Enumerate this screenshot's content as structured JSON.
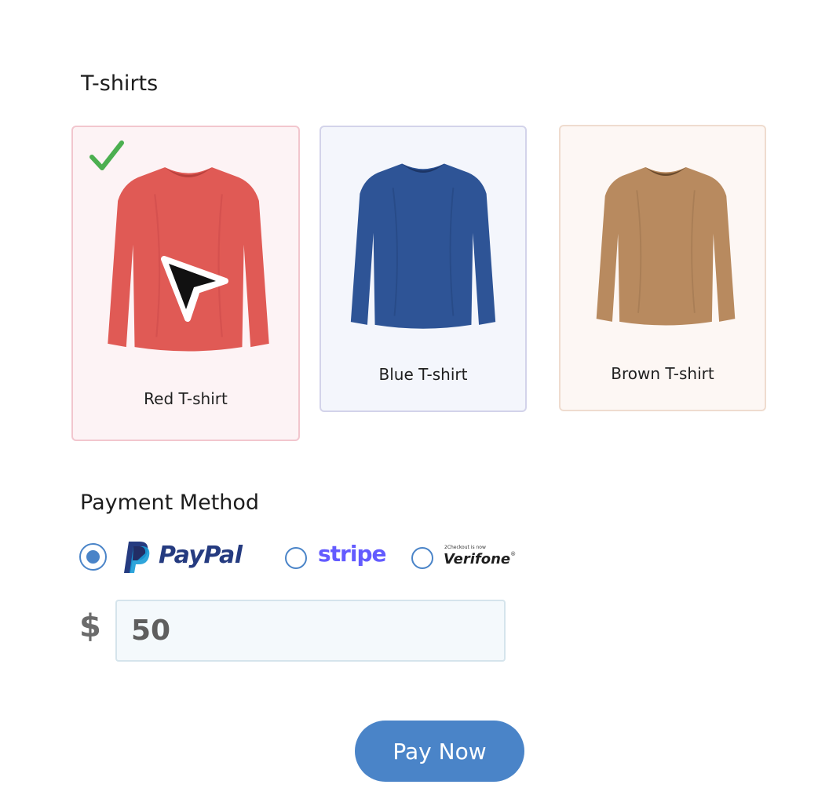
{
  "sections": {
    "tshirts_title": "T-shirts",
    "payment_title": "Payment Method"
  },
  "products": [
    {
      "label": "Red T-shirt",
      "color": "#e05a55",
      "selected": true
    },
    {
      "label": "Blue T-shirt",
      "color": "#2e5496",
      "selected": false
    },
    {
      "label": "Brown T-shirt",
      "color": "#b88a5f",
      "selected": false
    }
  ],
  "payment": {
    "methods": [
      {
        "name": "PayPal",
        "selected": true
      },
      {
        "name": "stripe",
        "selected": false
      },
      {
        "name": "Verifone",
        "tagline": "2Checkout is now",
        "selected": false
      }
    ],
    "currency_symbol": "$",
    "amount": "50"
  },
  "button": {
    "label": "Pay Now"
  },
  "colors": {
    "accent": "#4a84c8",
    "check": "#4caf50"
  },
  "icons": {
    "selected_mark": "check-icon",
    "pointer": "cursor-icon"
  }
}
